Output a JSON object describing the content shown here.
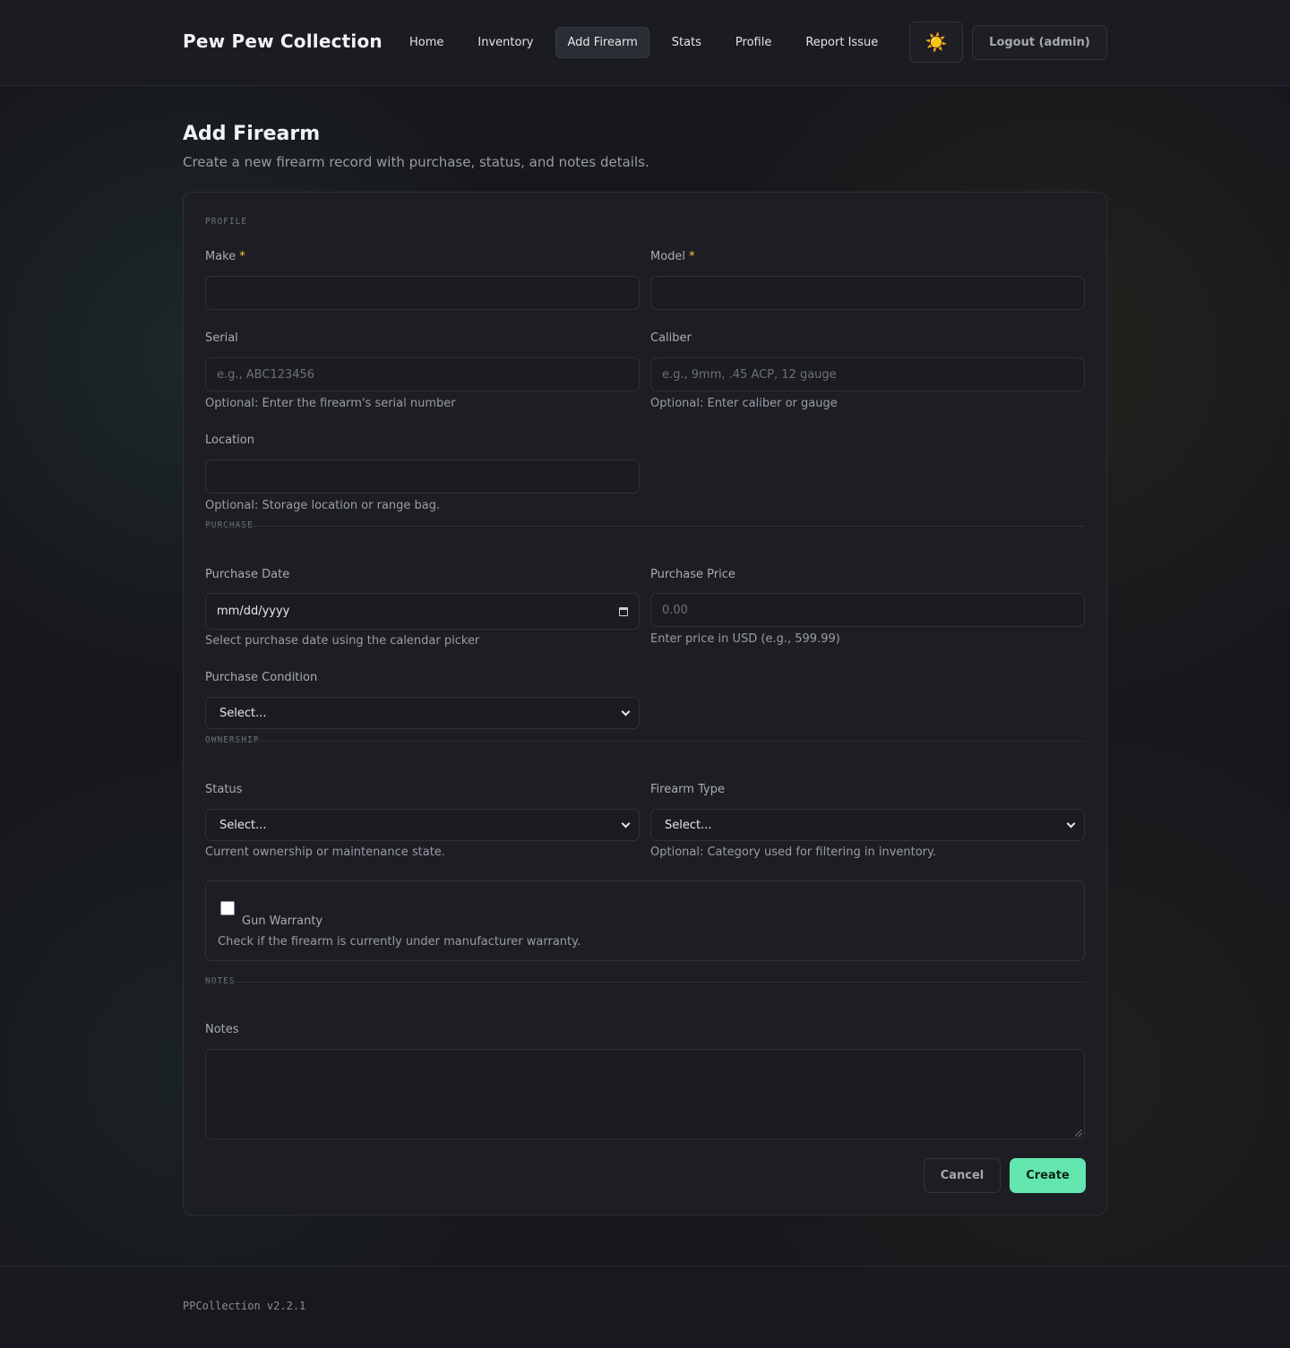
{
  "app": {
    "brand": "Pew Pew Collection"
  },
  "nav": {
    "items": [
      {
        "label": "Home",
        "active": false
      },
      {
        "label": "Inventory",
        "active": false
      },
      {
        "label": "Add Firearm",
        "active": true
      },
      {
        "label": "Stats",
        "active": false
      },
      {
        "label": "Profile",
        "active": false
      },
      {
        "label": "Report Issue",
        "active": false
      }
    ],
    "theme_icon": "sun-icon",
    "theme_glyph": "☀️",
    "logout_label": "Logout (admin)"
  },
  "page": {
    "title": "Add Firearm",
    "subtitle": "Create a new firearm record with purchase, status, and notes details."
  },
  "form": {
    "sections": {
      "profile": "PROFILE",
      "purchase": "PURCHASE",
      "ownership": "OWNERSHIP",
      "notes": "NOTES"
    },
    "required_marker": "*",
    "make": {
      "label": "Make",
      "value": "",
      "placeholder": ""
    },
    "model": {
      "label": "Model",
      "value": "",
      "placeholder": ""
    },
    "serial": {
      "label": "Serial",
      "value": "",
      "placeholder": "e.g., ABC123456",
      "help": "Optional: Enter the firearm's serial number"
    },
    "caliber": {
      "label": "Caliber",
      "value": "",
      "placeholder": "e.g., 9mm, .45 ACP, 12 gauge",
      "help": "Optional: Enter caliber or gauge"
    },
    "location": {
      "label": "Location",
      "value": "",
      "placeholder": "",
      "help": "Optional: Storage location or range bag."
    },
    "purchase_date": {
      "label": "Purchase Date",
      "value": "mm/dd/yyyy",
      "help": "Select purchase date using the calendar picker"
    },
    "purchase_price": {
      "label": "Purchase Price",
      "value": "",
      "placeholder": "0.00",
      "help": "Enter price in USD (e.g., 599.99)"
    },
    "purchase_condition": {
      "label": "Purchase Condition",
      "selected": "Select..."
    },
    "status": {
      "label": "Status",
      "selected": "Select...",
      "help": "Current ownership or maintenance state."
    },
    "firearm_type": {
      "label": "Firearm Type",
      "selected": "Select...",
      "help": "Optional: Category used for filtering in inventory."
    },
    "warranty": {
      "label": "Gun Warranty",
      "checked": false,
      "help": "Check if the firearm is currently under manufacturer warranty."
    },
    "notes": {
      "label": "Notes",
      "value": ""
    },
    "cancel_label": "Cancel",
    "create_label": "Create"
  },
  "footer": {
    "version": "PPCollection v2.2.1"
  },
  "colors": {
    "accent": "#63e6b0",
    "required": "#f5c542",
    "background": "#17181d",
    "card": "#1d1e24"
  }
}
